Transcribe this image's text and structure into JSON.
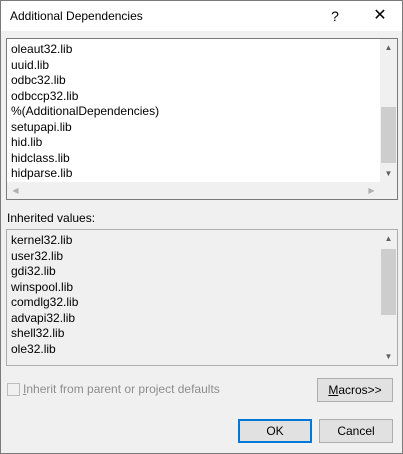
{
  "window": {
    "title": "Additional Dependencies",
    "help_glyph": "?",
    "close_glyph": "✕"
  },
  "edit_list": {
    "lines": [
      "oleaut32.lib",
      "uuid.lib",
      "odbc32.lib",
      "odbccp32.lib",
      "%(AdditionalDependencies)",
      "setupapi.lib",
      "hid.lib",
      "hidclass.lib",
      "hidparse.lib"
    ]
  },
  "inherited": {
    "label": "Inherited values:",
    "lines": [
      "kernel32.lib",
      "user32.lib",
      "gdi32.lib",
      "winspool.lib",
      "comdlg32.lib",
      "advapi32.lib",
      "shell32.lib",
      "ole32.lib"
    ]
  },
  "inherit_checkbox": {
    "label_first": "I",
    "label_rest": "nherit from parent or project defaults",
    "checked": false
  },
  "buttons": {
    "macros_first": "M",
    "macros_rest": "acros>>",
    "ok": "OK",
    "cancel": "Cancel"
  },
  "colors": {
    "accent_border": "#0078d7",
    "dialog_bg": "#f0f0f0"
  }
}
